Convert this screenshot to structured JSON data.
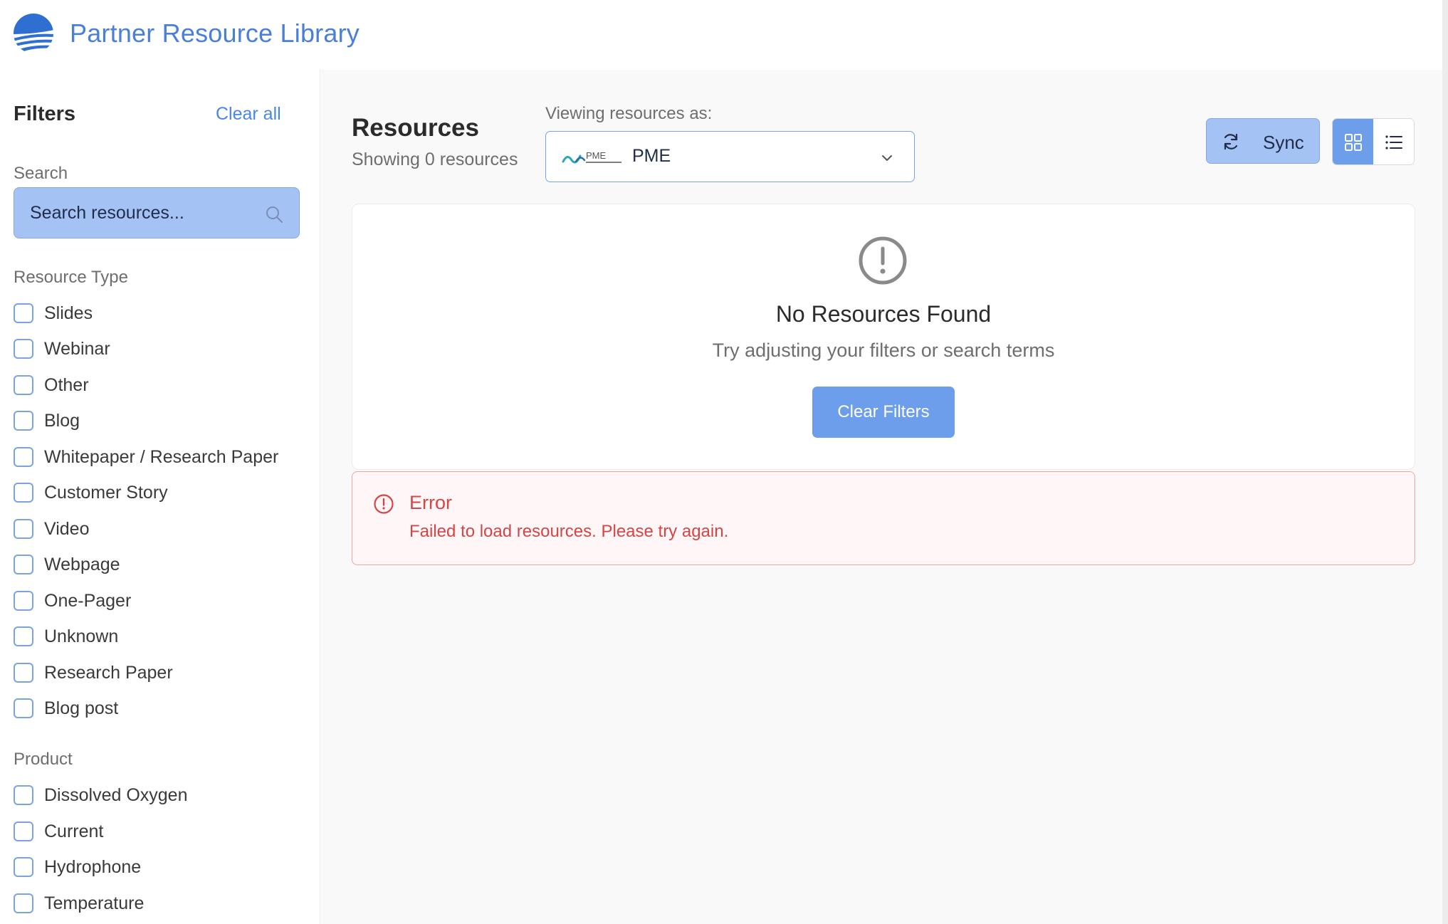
{
  "header": {
    "title": "Partner Resource Library",
    "logo_icon": "wave-globe-logo",
    "brand_color": "#4a7fd9"
  },
  "sidebar": {
    "title": "Filters",
    "clear_all": "Clear all",
    "search": {
      "label": "Search",
      "placeholder": "Search resources..."
    },
    "resource_type": {
      "label": "Resource Type",
      "options": [
        "Slides",
        "Webinar",
        "Other",
        "Blog",
        "Whitepaper / Research Paper",
        "Customer Story",
        "Video",
        "Webpage",
        "One-Pager",
        "Unknown",
        "Research Paper",
        "Blog post"
      ]
    },
    "product": {
      "label": "Product",
      "options": [
        "Dissolved Oxygen",
        "Current",
        "Hydrophone",
        "Temperature"
      ]
    }
  },
  "main": {
    "title": "Resources",
    "count_text": "Showing 0 resources",
    "viewing_label": "Viewing resources as:",
    "selected_partner": "PME",
    "partner_logo_text": "PME",
    "sync_label": "Sync",
    "empty": {
      "title": "No Resources Found",
      "subtitle": "Try adjusting your filters or search terms",
      "button": "Clear Filters"
    },
    "error": {
      "title": "Error",
      "message": "Failed to load resources. Please try again.",
      "color": "#d64545"
    },
    "accent_color": "#6d9eeb"
  }
}
